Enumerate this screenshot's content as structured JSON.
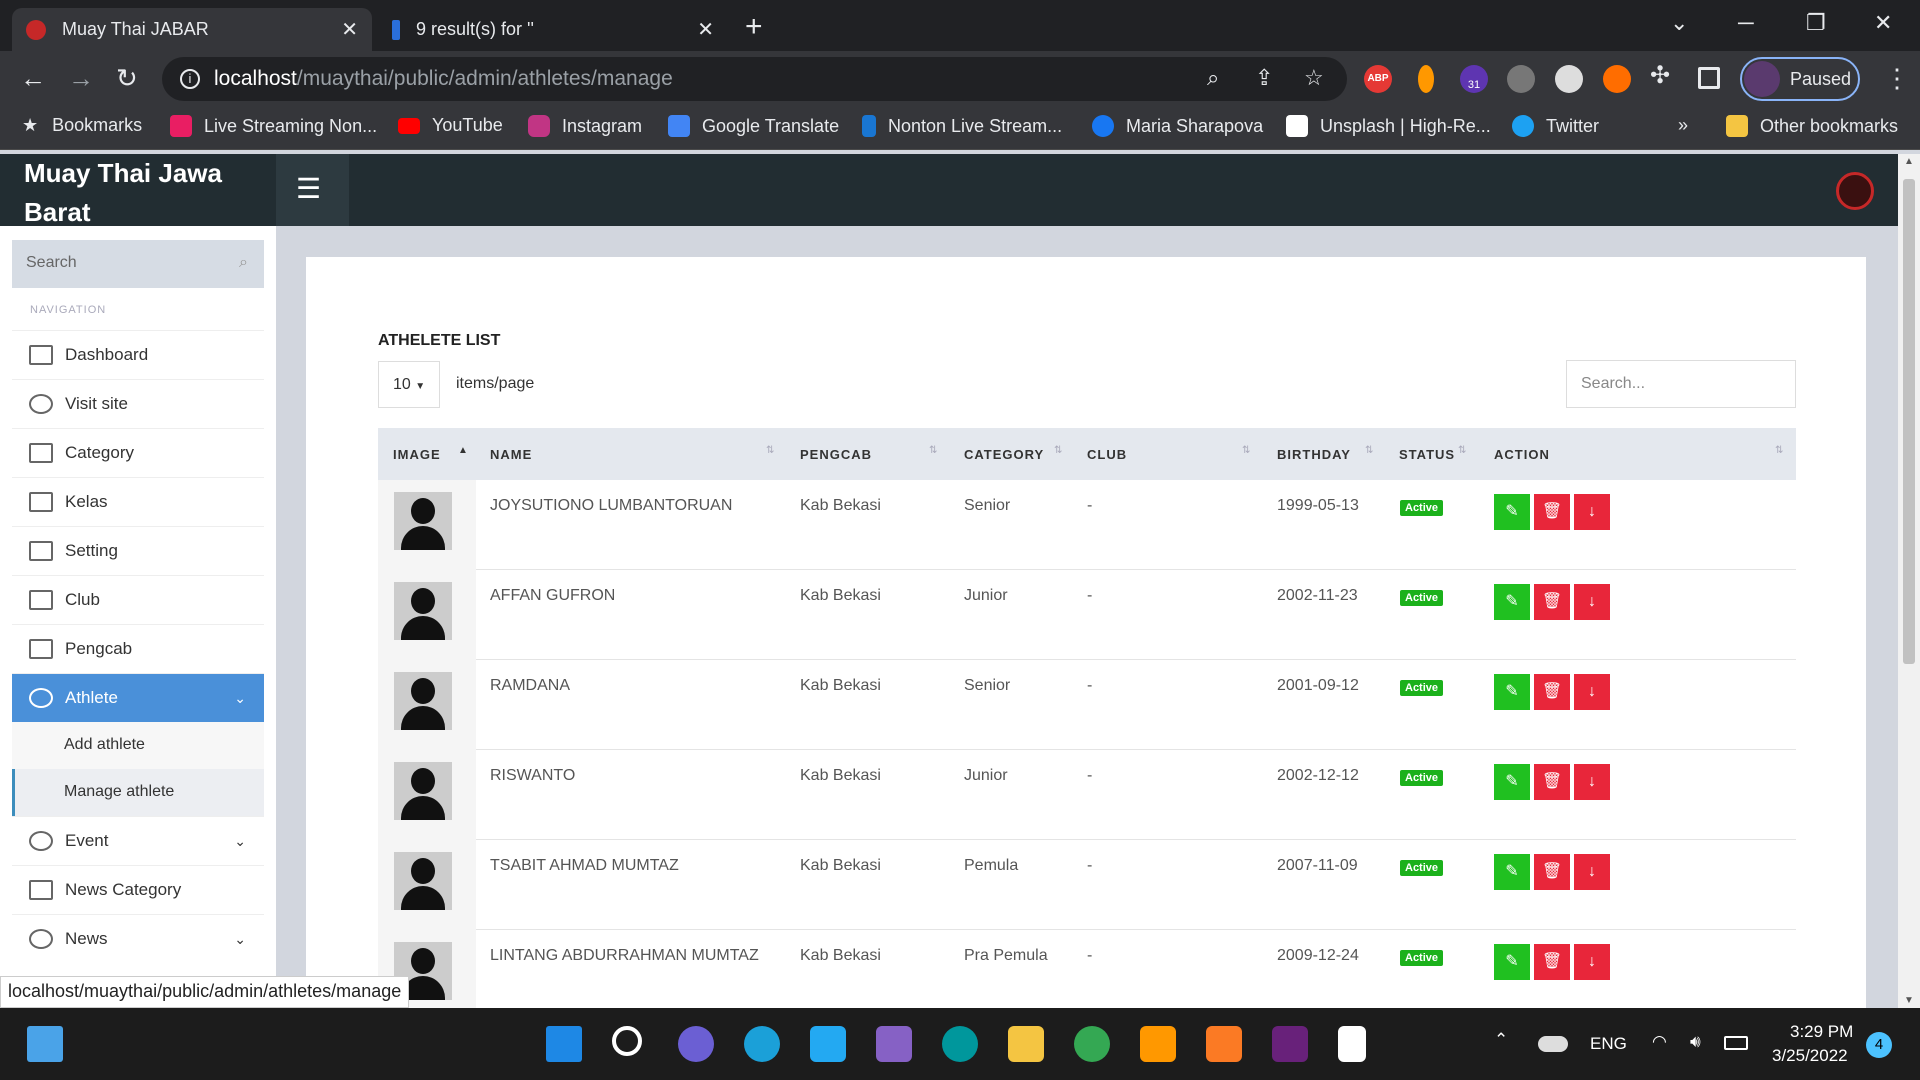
{
  "browser": {
    "tabs": [
      {
        "title": "Muay Thai JABAR",
        "active": true
      },
      {
        "title": "9 result(s) for ''",
        "active": false
      }
    ],
    "url_host": "localhost",
    "url_path": "/muaythai/public/admin/athletes/manage",
    "profile_status": "Paused",
    "extension_badge": "31",
    "adblock_label": "ABP",
    "bookmarks": [
      "Bookmarks",
      "Live Streaming Non...",
      "YouTube",
      "Instagram",
      "Google Translate",
      "Nonton Live Stream...",
      "Maria Sharapova",
      "Unsplash | High-Re...",
      "Twitter"
    ],
    "more_bookmarks": "»",
    "other_bookmarks": "Other bookmarks",
    "status_url": "localhost/muaythai/public/admin/athletes/manage"
  },
  "app": {
    "brand": "Muay Thai Jawa Barat",
    "sidebar_search_placeholder": "Search",
    "nav_heading": "NAVIGATION",
    "nav": [
      {
        "label": "Dashboard",
        "icon": "home-icon"
      },
      {
        "label": "Visit site",
        "icon": "globe-icon"
      },
      {
        "label": "Category",
        "icon": "book-icon"
      },
      {
        "label": "Kelas",
        "icon": "book-icon"
      },
      {
        "label": "Setting",
        "icon": "book-icon"
      },
      {
        "label": "Club",
        "icon": "book-icon"
      },
      {
        "label": "Pengcab",
        "icon": "book-icon"
      },
      {
        "label": "Athlete",
        "icon": "pie-chart-icon",
        "active": true
      },
      {
        "label": "Event",
        "icon": "pie-chart-icon"
      },
      {
        "label": "News Category",
        "icon": "book-icon"
      },
      {
        "label": "News",
        "icon": "pie-chart-icon"
      }
    ],
    "athlete_sub": [
      "Add athlete",
      "Manage athlete"
    ]
  },
  "main": {
    "list_title": "ATHELETE LIST",
    "per_page": "10",
    "per_page_label": "items/page",
    "search_placeholder": "Search...",
    "columns": [
      "IMAGE",
      "NAME",
      "PENGCAB",
      "CATEGORY",
      "CLUB",
      "BIRTHDAY",
      "STATUS",
      "ACTION"
    ],
    "rows": [
      {
        "name": "JOYSUTIONO LUMBANTORUAN",
        "pengcab": "Kab Bekasi",
        "category": "Senior",
        "club": "-",
        "birthday": "1999-05-13",
        "status": "Active"
      },
      {
        "name": "AFFAN GUFRON",
        "pengcab": "Kab Bekasi",
        "category": "Junior",
        "club": "-",
        "birthday": "2002-11-23",
        "status": "Active"
      },
      {
        "name": "RAMDANA",
        "pengcab": "Kab Bekasi",
        "category": "Senior",
        "club": "-",
        "birthday": "2001-09-12",
        "status": "Active"
      },
      {
        "name": "RISWANTO",
        "pengcab": "Kab Bekasi",
        "category": "Junior",
        "club": "-",
        "birthday": "2002-12-12",
        "status": "Active"
      },
      {
        "name": "TSABIT AHMAD MUMTAZ",
        "pengcab": "Kab Bekasi",
        "category": "Pemula",
        "club": "-",
        "birthday": "2007-11-09",
        "status": "Active"
      },
      {
        "name": "LINTANG ABDURRAHMAN MUMTAZ",
        "pengcab": "Kab Bekasi",
        "category": "Pra Pemula",
        "club": "-",
        "birthday": "2009-12-24",
        "status": "Active"
      }
    ]
  },
  "taskbar": {
    "lang": "ENG",
    "time": "3:29 PM",
    "date": "3/25/2022",
    "notif_count": "4"
  }
}
